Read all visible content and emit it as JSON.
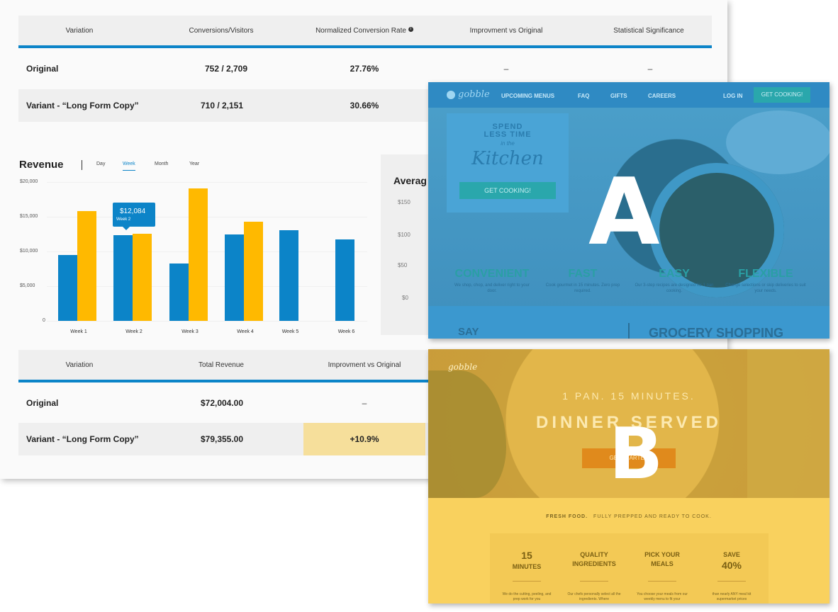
{
  "conversion_table": {
    "headers": [
      "Variation",
      "Conversions/Visitors",
      "Normalized Conversion Rate",
      "Improvment vs Original",
      "Statistical Significance"
    ],
    "info_icon": "info-icon",
    "rows": [
      {
        "variation": "Original",
        "conversions": "752 / 2,709",
        "rate": "27.76%",
        "improvement": "–",
        "significance": "–"
      },
      {
        "variation": "Variant - “Long Form Copy”",
        "conversions": "710 / 2,151",
        "rate": "30.66%"
      }
    ]
  },
  "revenue_chart": {
    "title": "Revenue",
    "tabs": [
      "Day",
      "Week",
      "Month",
      "Year"
    ],
    "active_tab": "Week",
    "tooltip": {
      "value": "$12,084",
      "label": "Week 2"
    }
  },
  "chart_data": {
    "type": "bar",
    "title": "Revenue",
    "categories": [
      "Week 1",
      "Week 2",
      "Week 3",
      "Week 4",
      "Week 5",
      "Week 6"
    ],
    "series": [
      {
        "values": [
          9500,
          12300,
          8300,
          12400,
          13100,
          11700
        ],
        "color": "#0c84c8"
      },
      {
        "values": [
          15800,
          12600,
          19100,
          14300,
          null,
          null
        ],
        "color": "#ffb900"
      }
    ],
    "y_ticks": [
      "$20,000",
      "$15,000",
      "$10,000",
      "$5,000",
      "0"
    ],
    "ylim": [
      0,
      20000
    ]
  },
  "avg_panel": {
    "title": "Averag",
    "ticks": [
      "$150",
      "$100",
      "$50",
      "$0"
    ]
  },
  "revenue_table": {
    "headers": [
      "Variation",
      "Total Revenue",
      "Improvment vs Original"
    ],
    "rows": [
      {
        "variation": "Original",
        "total": "$72,004.00",
        "improvement": "–"
      },
      {
        "variation": "Variant - “Long Form Copy”",
        "total": "$79,355.00",
        "improvement": "+10.9%"
      }
    ]
  },
  "variant_a": {
    "logo": "gobble",
    "nav": [
      "UPCOMING MENUS",
      "FAQ",
      "GIFTS",
      "CAREERS"
    ],
    "login": "LOG IN",
    "cta": "GET COOKING!",
    "hero_line1": "SPEND",
    "hero_line2": "LESS TIME",
    "hero_inthe": "in the",
    "hero_kitchen": "Kitchen",
    "hero_button": "GET COOKING!",
    "features": [
      {
        "title": "CONVENIENT",
        "desc": "We shop, chop, and deliver right to your door."
      },
      {
        "title": "FAST",
        "desc": "Cook gourmet in 15 minutes. Zero prep required."
      },
      {
        "title": "EASY",
        "desc": "Our 3-step recipes are designed for 1 pan cooking."
      },
      {
        "title": "FLEXIBLE",
        "desc": "Change selections or skip deliveries to suit your needs."
      }
    ],
    "say": "SAY",
    "grocery": "GROCERY SHOPPING",
    "letter": "A",
    "accent": "#3b98cf"
  },
  "variant_b": {
    "logo": "gobble",
    "line1": "1 PAN. 15 MINUTES.",
    "line2": "DINNER SERVED",
    "button": "GET STARTED",
    "letter": "B",
    "fresh_bold": "FRESH FOOD.",
    "fresh_rest": "FULLY PREPPED AND READY TO COOK.",
    "panel": [
      {
        "top": "15",
        "bottom": "MINUTES",
        "desc": "We do the cutting, peeling, and prep work for you"
      },
      {
        "top": "QUALITY",
        "bottom": "INGREDIENTS",
        "desc": "Our chefs personally select all the ingredients. Where"
      },
      {
        "top": "PICK YOUR",
        "bottom": "MEALS",
        "desc": "You choose your meals from our weekly menu to fit your"
      },
      {
        "top": "SAVE",
        "bottom": "40%",
        "desc": "than nearly ANY meal kit supermarket prices"
      }
    ],
    "accent": "#f5c94e"
  }
}
